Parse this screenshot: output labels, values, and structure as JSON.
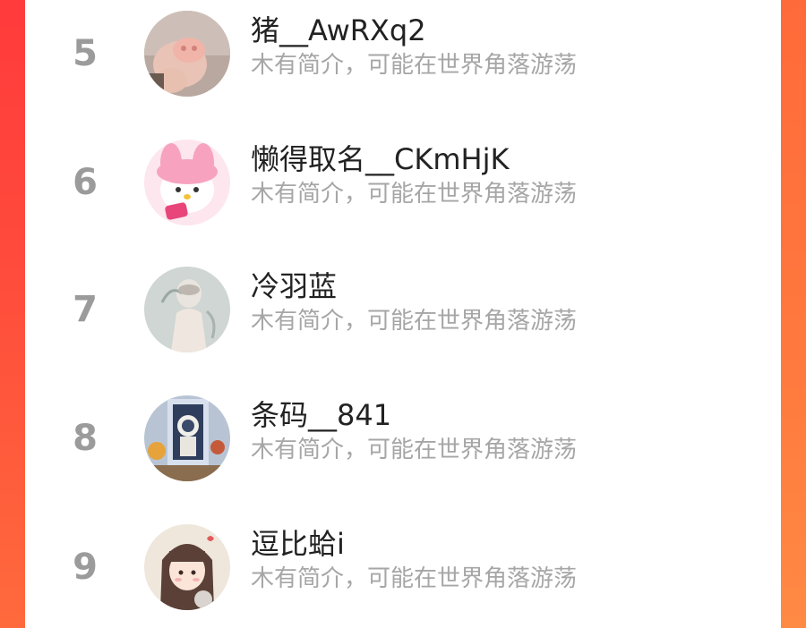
{
  "ranking": {
    "items": [
      {
        "rank": "5",
        "name": "猪__AwRXq2",
        "bio": "木有简介，可能在世界角落游荡",
        "avatar_icon": "pig-toy-photo-avatar"
      },
      {
        "rank": "6",
        "name": "懒得取名__CKmHjK",
        "bio": "木有简介，可能在世界角落游荡",
        "avatar_icon": "pink-bunny-cartoon-avatar"
      },
      {
        "rank": "7",
        "name": "冷羽蓝",
        "bio": "木有简介，可能在世界角落游荡",
        "avatar_icon": "pale-portrait-avatar"
      },
      {
        "rank": "8",
        "name": "条码__841",
        "bio": "木有简介，可能在世界角落游荡",
        "avatar_icon": "astronaut-figure-avatar"
      },
      {
        "rank": "9",
        "name": "逗比蛤i",
        "bio": "木有简介，可能在世界角落游荡",
        "avatar_icon": "cartoon-girl-avatar"
      }
    ]
  },
  "colors": {
    "background_red": "#ff3b3b",
    "background_orange": "#ff8a44",
    "rank_gray": "#9b9b9b",
    "name_text": "#222222",
    "bio_text": "#a6a6a6"
  }
}
